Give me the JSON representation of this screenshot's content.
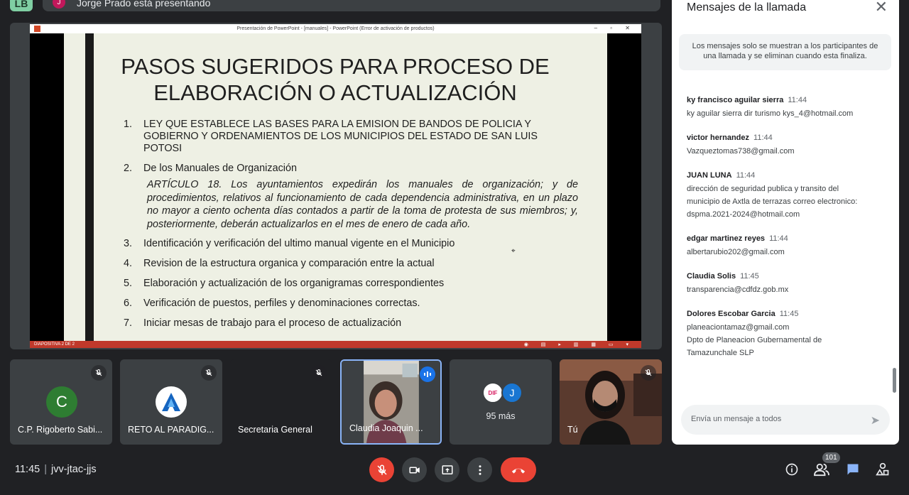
{
  "top": {
    "self_avatar": "LB",
    "presenter_initial": "J",
    "presenting_text": "Jorge Prado está presentando"
  },
  "presentation": {
    "window_title": "Presentación de PowerPoint - [manuales] - PowerPoint (Error de activación de productos)",
    "status_text": "DIAPOSITIVA 2 DE 2",
    "slide": {
      "title_line1": "PASOS SUGERIDOS PARA PROCESO DE",
      "title_line2": "ELABORACIÓN O ACTUALIZACIÓN",
      "items": [
        {
          "num": "1.",
          "text": "LEY QUE ESTABLECE LAS BASES PARA LA EMISION DE BANDOS DE POLICIA Y GOBIERNO Y ORDENAMIENTOS DE LOS MUNICIPIOS DEL ESTADO DE SAN LUIS POTOSI"
        },
        {
          "num": "2.",
          "text": "De los Manuales de Organización"
        },
        {
          "num": "3.",
          "text": "Identificación y verificación del ultimo manual vigente en el Municipio"
        },
        {
          "num": "4.",
          "text": "Revision de la estructura organica y comparación entre la actual"
        },
        {
          "num": "5.",
          "text": "Elaboración y actualización de los organigramas correspondientes"
        },
        {
          "num": "6.",
          "text": "Verificación de puestos, perfiles y denominaciones correctas."
        },
        {
          "num": "7.",
          "text": "Iniciar mesas de trabajo para el proceso de actualización"
        }
      ],
      "quote": "ARTÍCULO 18. Los ayuntamientos expedirán los manuales de organización; y de procedimientos, relativos al funcionamiento de cada dependencia administrativa, en un plazo no mayor a ciento ochenta días contados a partir de la toma de protesta de sus miembros; y, posteriormente, deberán actualizarlos en el mes de enero de cada año."
    }
  },
  "chat": {
    "title": "Mensajes de la llamada",
    "notice": "Los mensajes solo se muestran a los participantes de una llamada y se eliminan cuando esta finaliza.",
    "input_placeholder": "Envía un mensaje a todos",
    "messages": [
      {
        "name": "ky francisco aguilar sierra",
        "time": "11:44",
        "lines": [
          "ky aguilar sierra dir turismo kys_4@hotmail.com"
        ]
      },
      {
        "name": "victor hernandez",
        "time": "11:44",
        "lines": [
          "Vazqueztomas738@gmail.com"
        ]
      },
      {
        "name": "JUAN LUNA",
        "time": "11:44",
        "lines": [
          "dirección de seguridad publica y transito del",
          "municipio de Axtla de terrazas  correo electronico:",
          "dspma.2021-2024@hotmail.com"
        ]
      },
      {
        "name": "edgar martinez reyes",
        "time": "11:44",
        "lines": [
          "albertarubio202@gmail.com"
        ]
      },
      {
        "name": "Claudia Solis",
        "time": "11:45",
        "lines": [
          "transparencia@cdfdz.gob.mx"
        ]
      },
      {
        "name": "Dolores Escobar Garcia",
        "time": "11:45",
        "lines": [
          "planeaciontamaz@gmail.com",
          "Dpto de Planeacion Gubernamental de",
          "Tamazunchale SLP"
        ]
      }
    ]
  },
  "tiles": [
    {
      "name": "C.P. Rigoberto Sabi...",
      "avatar": "C",
      "avatar_color": "#2e7d32",
      "muted": true
    },
    {
      "name": "RETO AL PARADIG...",
      "avatar": "logo",
      "muted": true
    },
    {
      "name": "Secretaria General",
      "muted": true
    },
    {
      "name": "Claudia Joaquin ...",
      "video": true,
      "speaking": true
    },
    {
      "avatars": [
        "DIF",
        "J"
      ],
      "count": "95 más"
    },
    {
      "name": "Tú",
      "video": true,
      "muted": true
    }
  ],
  "bottom": {
    "time": "11:45",
    "separator": "|",
    "meeting_code": "jvv-jtac-jjs",
    "participants_badge": "101"
  },
  "colors": {
    "accent_blue": "#8ab4f8",
    "end_call_red": "#ea4335",
    "chat_icon_blue": "#8ab4f8"
  }
}
